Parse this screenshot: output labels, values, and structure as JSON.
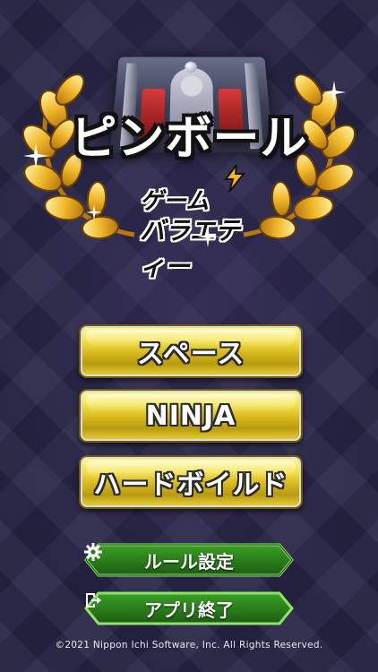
{
  "logo": {
    "title": "ピンボール",
    "subtitle_line1": "ゲーム",
    "subtitle_line2": "バラエティー"
  },
  "modes": [
    {
      "label": "スペース"
    },
    {
      "label": "NINJA"
    },
    {
      "label": "ハードボイルド"
    }
  ],
  "options": {
    "rules": {
      "label": "ルール設定",
      "icon": "gear-icon"
    },
    "exit": {
      "label": "アプリ終了",
      "icon": "exit-icon"
    }
  },
  "footer": {
    "copyright": "©2021 Nippon Ichi Software, Inc. All Rights Reserved."
  },
  "colors": {
    "background": "#272445",
    "gold": "#e8cf2e",
    "option_green": "#2f8a1e",
    "option_border": "#8fe36a"
  }
}
